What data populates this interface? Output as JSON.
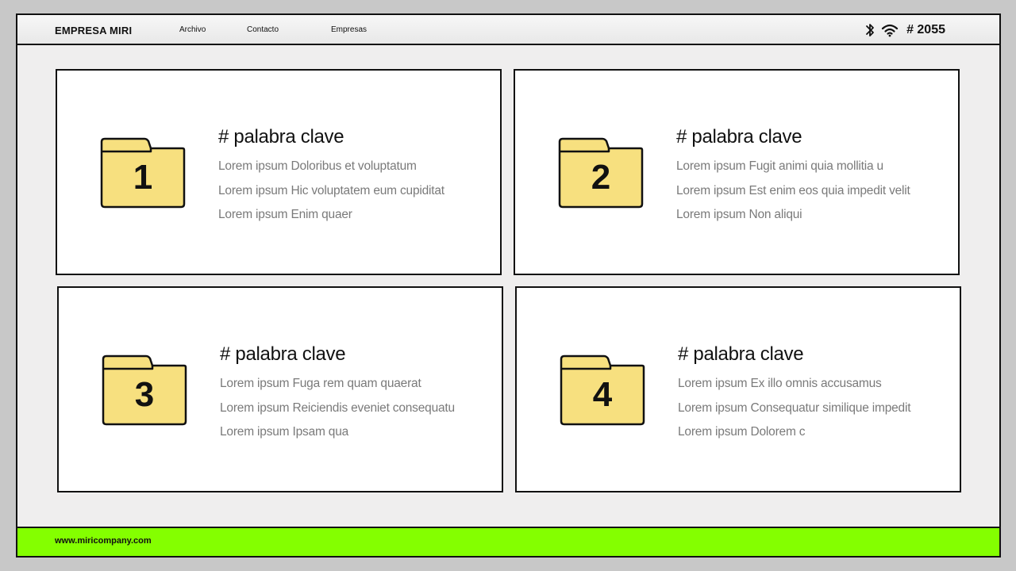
{
  "header": {
    "brand": "EMPRESA MIRI",
    "nav": [
      "Archivo",
      "Contacto",
      "Empresas"
    ],
    "status_text": "# 2055",
    "status_icons": [
      "bluetooth-icon",
      "wifi-icon"
    ]
  },
  "cards": [
    {
      "number": "1",
      "title": "# palabra clave",
      "lines": [
        "Lorem ipsum Doloribus et voluptatum",
        "Lorem ipsum Hic voluptatem eum cupiditat",
        "Lorem ipsum Enim quaer"
      ]
    },
    {
      "number": "2",
      "title": "# palabra clave",
      "lines": [
        "Lorem ipsum Fugit animi quia mollitia u",
        "Lorem ipsum Est enim eos quia impedit velit",
        "Lorem ipsum Non aliqui"
      ]
    },
    {
      "number": "3",
      "title": "# palabra clave",
      "lines": [
        "Lorem ipsum Fuga rem quam quaerat",
        "Lorem ipsum Reiciendis eveniet consequatu",
        "Lorem ipsum Ipsam qua"
      ]
    },
    {
      "number": "4",
      "title": "# palabra clave",
      "lines": [
        "Lorem ipsum Ex illo omnis accusamus",
        "Lorem ipsum Consequatur similique impedit",
        "Lorem ipsum Dolorem c"
      ]
    }
  ],
  "footer": {
    "url": "www.miricompany.com"
  },
  "colors": {
    "accent": "#84ff00",
    "folder": "#f7e07f",
    "border": "#111111",
    "background": "#efeeee",
    "muted_text": "#7a7a7a"
  }
}
